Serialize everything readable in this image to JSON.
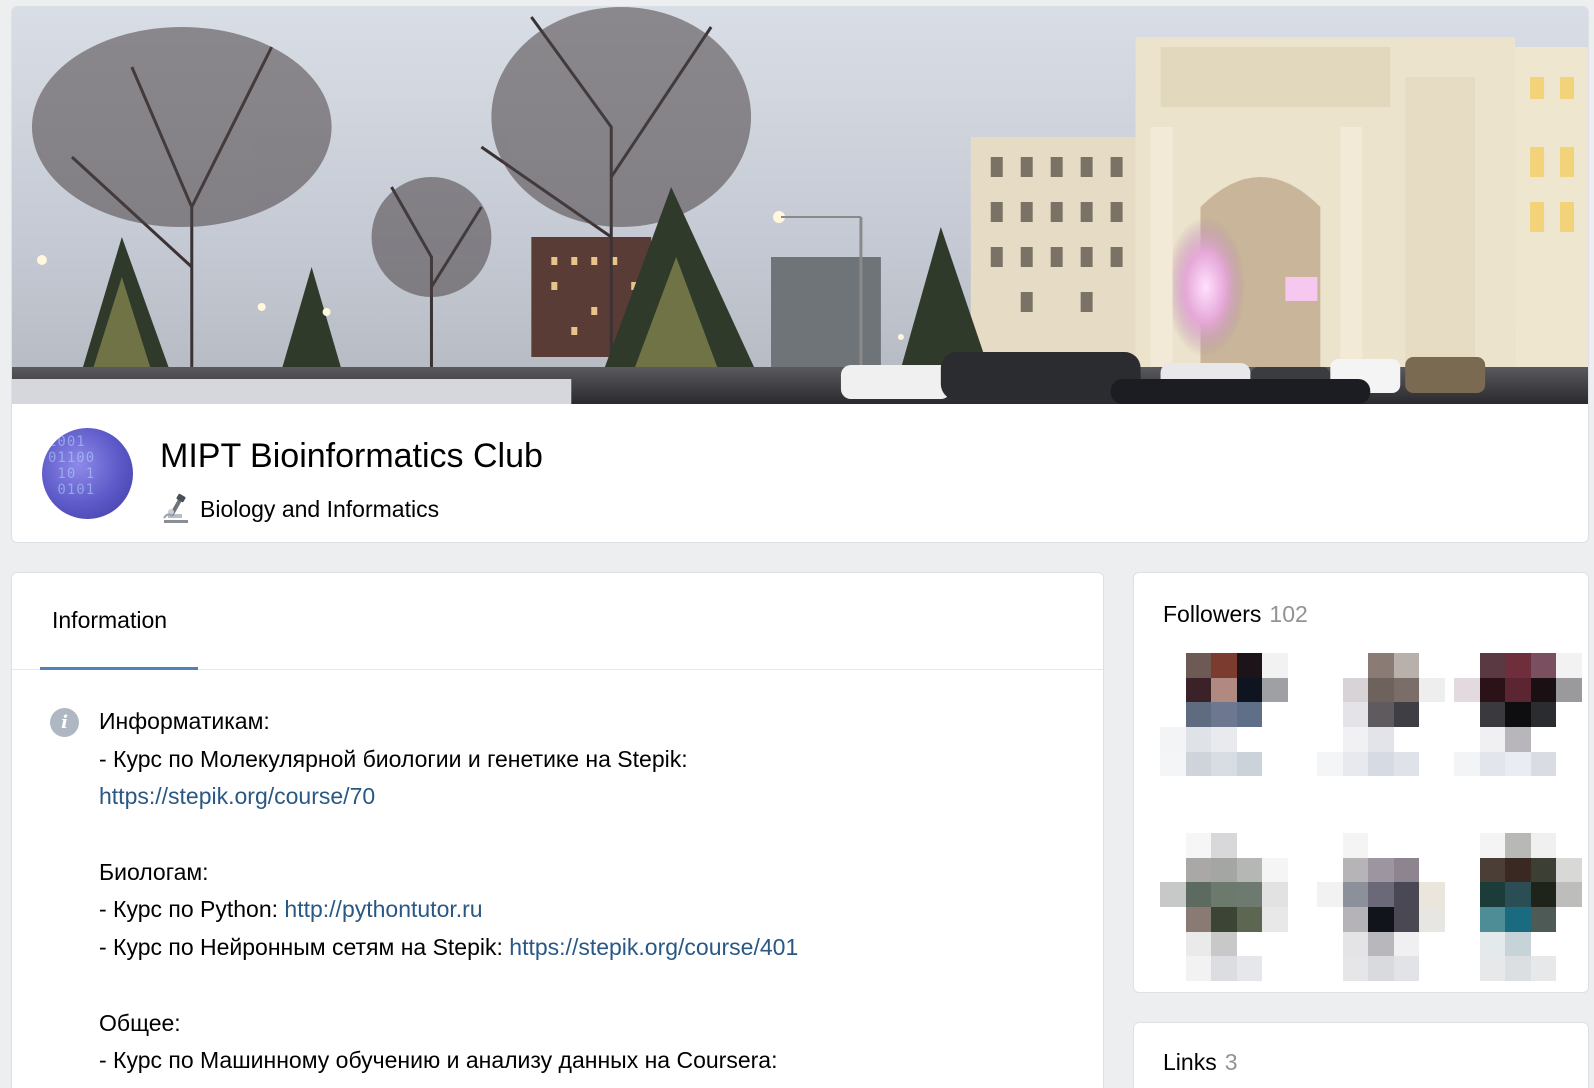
{
  "group": {
    "name": "MIPT Bioinformatics Club",
    "status": "Biology and Informatics",
    "status_icon": "microscope-icon"
  },
  "tabs": [
    {
      "label": "Information",
      "active": true
    }
  ],
  "info": {
    "icon": "info-icon",
    "lines": [
      {
        "text": "Информатикам:",
        "link": ""
      },
      {
        "text": "- Курс по Молекулярной биологии и генетике на Stepik:",
        "link": ""
      },
      {
        "text": "",
        "link": "https://stepik.org/course/70"
      },
      {
        "text": "",
        "link": ""
      },
      {
        "text": "Биологам:",
        "link": ""
      },
      {
        "text": "- Курс по Python: ",
        "link": "http://pythontutor.ru"
      },
      {
        "text": "- Курс по Нейронным сетям на Stepik: ",
        "link": "https://stepik.org/course/401"
      },
      {
        "text": "",
        "link": ""
      },
      {
        "text": "Общее:",
        "link": ""
      },
      {
        "text": "- Курс по Машинному обучению и анализу данных на Coursera:",
        "link": ""
      }
    ]
  },
  "followers": {
    "title": "Followers",
    "count": "102",
    "avatars": [
      {
        "colors": [
          "#fff",
          "#6e5a55",
          "#7b3b2e",
          "#1c1418",
          "#f2f2f2",
          "#fff",
          "#3a2228",
          "#b08a80",
          "#0f1520",
          "#9fa0a3",
          "#fff",
          "#5f6c80",
          "#6d7890",
          "#5f6f88",
          "#fff",
          "#f3f4f6",
          "#dfe2e7",
          "#e8eaee",
          "#fff",
          "#fff",
          "#f4f5f7",
          "#cfd4db",
          "#d8dde3",
          "#ccd2d9",
          "#fff",
          "#fff",
          "#fff",
          "#fff",
          "#fff",
          "#fff"
        ]
      },
      {
        "colors": [
          "#fff",
          "#fff",
          "#8a7c74",
          "#b8b0aa",
          "#fff",
          "#fff",
          "#d7d3d6",
          "#6e625c",
          "#7b6e68",
          "#eee",
          "#fff",
          "#e4e4e8",
          "#5e5a5e",
          "#3e3e44",
          "#fff",
          "#fff",
          "#f1f1f3",
          "#e2e4e9",
          "#fff",
          "#fff",
          "#f4f5f7",
          "#e7e9ee",
          "#d6dae2",
          "#dfe2e8",
          "#fff",
          "#fff",
          "#fff",
          "#fff",
          "#fff",
          "#fff"
        ]
      },
      {
        "colors": [
          "#fff",
          "#5a3942",
          "#6e2e3c",
          "#7a5060",
          "#f2f2f2",
          "#e2dadf",
          "#2a1218",
          "#5c2532",
          "#1a1014",
          "#9a9a9c",
          "#fff",
          "#3a3a3e",
          "#0e0e10",
          "#2a2c30",
          "#fff",
          "#fff",
          "#f0f0f2",
          "#b8b6bb",
          "#fff",
          "#fff",
          "#f3f4f6",
          "#e2e6ec",
          "#e9edf3",
          "#d9dde3",
          "#fff",
          "#fff",
          "#fff",
          "#fff",
          "#fff",
          "#fff"
        ]
      },
      {
        "colors": [
          "#fff",
          "#f6f6f7",
          "#d8d8da",
          "#fff",
          "#fff",
          "#fff",
          "#a9a8a6",
          "#a3a6a2",
          "#b4b7b3",
          "#f5f5f5",
          "#c7c9c8",
          "#5d6a60",
          "#6b7a6c",
          "#6e7a6f",
          "#e2e2e2",
          "#fff",
          "#8a7a74",
          "#3c4436",
          "#5c6650",
          "#e8e8e8",
          "#fff",
          "#eaeaea",
          "#c8c8c8",
          "#fff",
          "#fff",
          "#fff",
          "#f2f2f3",
          "#dcdde0",
          "#e6e7ea",
          "#fff"
        ]
      },
      {
        "colors": [
          "#fff",
          "#f4f4f5",
          "#fff",
          "#fff",
          "#fff",
          "#fff",
          "#b7b4b8",
          "#9d96a0",
          "#8d8490",
          "#fff",
          "#f2f2f3",
          "#8b909a",
          "#6b6878",
          "#4a4854",
          "#eae6dc",
          "#fff",
          "#b5b3b8",
          "#12141c",
          "#4a4852",
          "#e8e6e2",
          "#fff",
          "#e4e4e6",
          "#b8b8bc",
          "#f0f0f2",
          "#fff",
          "#fff",
          "#e6e6e8",
          "#d8dadd",
          "#e2e3e6",
          "#fff"
        ]
      },
      {
        "colors": [
          "#fff",
          "#f4f4f4",
          "#b8b8b6",
          "#f0f0f0",
          "#fff",
          "#fff",
          "#4a3e36",
          "#3a2822",
          "#3c4034",
          "#d8d8d6",
          "#fff",
          "#1c3c3a",
          "#2a4e54",
          "#1e241a",
          "#bdbdbb",
          "#fff",
          "#4e8c96",
          "#1a6a80",
          "#4e5a56",
          "#fff",
          "#fff",
          "#e4eaec",
          "#c6d4da",
          "#fff",
          "#fff",
          "#fff",
          "#e6e8ea",
          "#dcdfe2",
          "#e6e8ea",
          "#fff"
        ]
      }
    ]
  },
  "links": {
    "title": "Links",
    "count": "3"
  }
}
